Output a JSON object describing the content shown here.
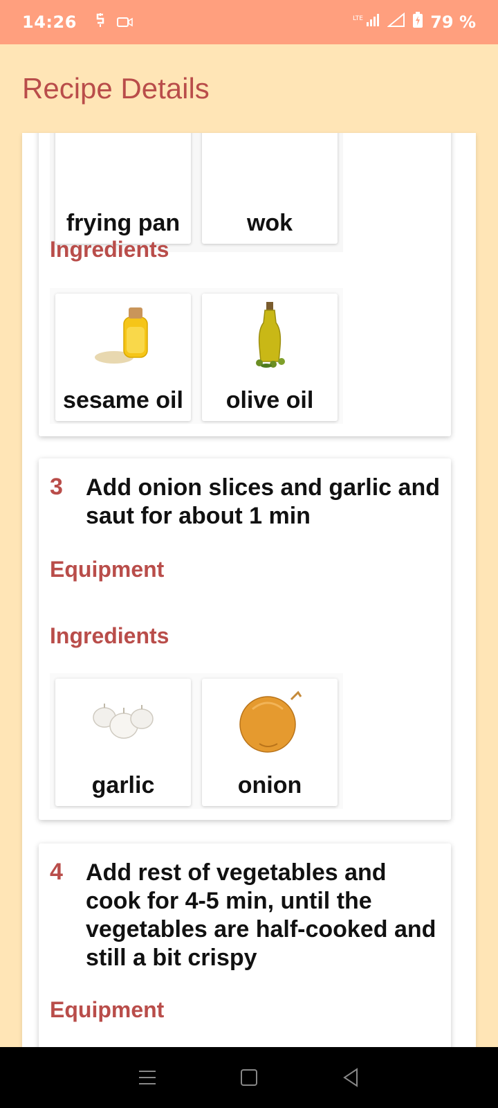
{
  "status_bar": {
    "time": "14:26",
    "battery": "79 %",
    "icons": [
      "sync-icon",
      "video-icon",
      "lte-signal-icon",
      "signal-icon",
      "battery-charging-icon"
    ]
  },
  "app_bar": {
    "title": "Recipe Details"
  },
  "steps": [
    {
      "equipment": [
        {
          "label": "frying pan",
          "icon": "frying-pan-icon"
        },
        {
          "label": "wok",
          "icon": "wok-icon"
        }
      ],
      "ingredients_label": "Ingredients",
      "ingredients": [
        {
          "label": "sesame oil",
          "icon": "sesame-oil-icon"
        },
        {
          "label": "olive oil",
          "icon": "olive-oil-icon"
        }
      ]
    },
    {
      "number": "3",
      "text": "Add onion slices and garlic and saut for about 1 min",
      "equipment_label": "Equipment",
      "ingredients_label": "Ingredients",
      "ingredients": [
        {
          "label": "garlic",
          "icon": "garlic-icon"
        },
        {
          "label": "onion",
          "icon": "onion-icon"
        }
      ]
    },
    {
      "number": "4",
      "text": "Add rest of vegetables and cook for 4-5 min, until the vegetables are half-cooked and still a bit crispy",
      "equipment_label": "Equipment"
    }
  ],
  "nav_bar": {
    "icons": [
      "menu-icon",
      "home-square-icon",
      "back-triangle-icon"
    ]
  },
  "colors": {
    "status_bar": "#FF9F7E",
    "app_bar": "#FFE5B6",
    "accent": "#B94D4A",
    "card": "#FFFFFF"
  }
}
